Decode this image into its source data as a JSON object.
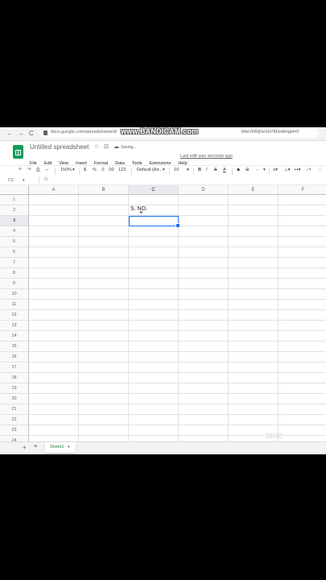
{
  "browser": {
    "back": "←",
    "forward": "→",
    "reload": "C",
    "url": "docs.google.com/spreadsheets/d/",
    "url_tail": "84eVRRjDeSH7M/edit#gid=0",
    "watermark": "www.BANDICAM.com"
  },
  "header": {
    "title": "Untitled spreadsheet",
    "star_icon": "☆",
    "folder_icon": "⊡",
    "saving_text": "Saving...",
    "menu": [
      "File",
      "Edit",
      "View",
      "Insert",
      "Format",
      "Data",
      "Tools",
      "Extensions",
      "Help"
    ],
    "last_edit": "Last edit was seconds ago"
  },
  "toolbar": {
    "zoom": "150%",
    "currency": "$",
    "percent": "%",
    "dec_less": ".0",
    "dec_more": ".00",
    "more_formats": "123",
    "font": "Default (Ari...",
    "font_size": "10",
    "bold": "B",
    "italic": "I",
    "strike": "S",
    "text_color": "A"
  },
  "formula_bar": {
    "name_box": "C3",
    "fx": "fx",
    "value": ""
  },
  "grid": {
    "columns": [
      "A",
      "B",
      "C",
      "D",
      "E",
      "F"
    ],
    "rows": [
      "1",
      "2",
      "3",
      "4",
      "5",
      "6",
      "7",
      "8",
      "9",
      "10",
      "11",
      "12",
      "13",
      "14",
      "15",
      "16",
      "17",
      "18",
      "19",
      "20",
      "21",
      "22",
      "23",
      "24"
    ],
    "active_cell": "C3",
    "cell_c2": "S. NO."
  },
  "sheets": {
    "add": "+",
    "all": "≡",
    "tab": "Sheet1",
    "caret": "▾"
  }
}
